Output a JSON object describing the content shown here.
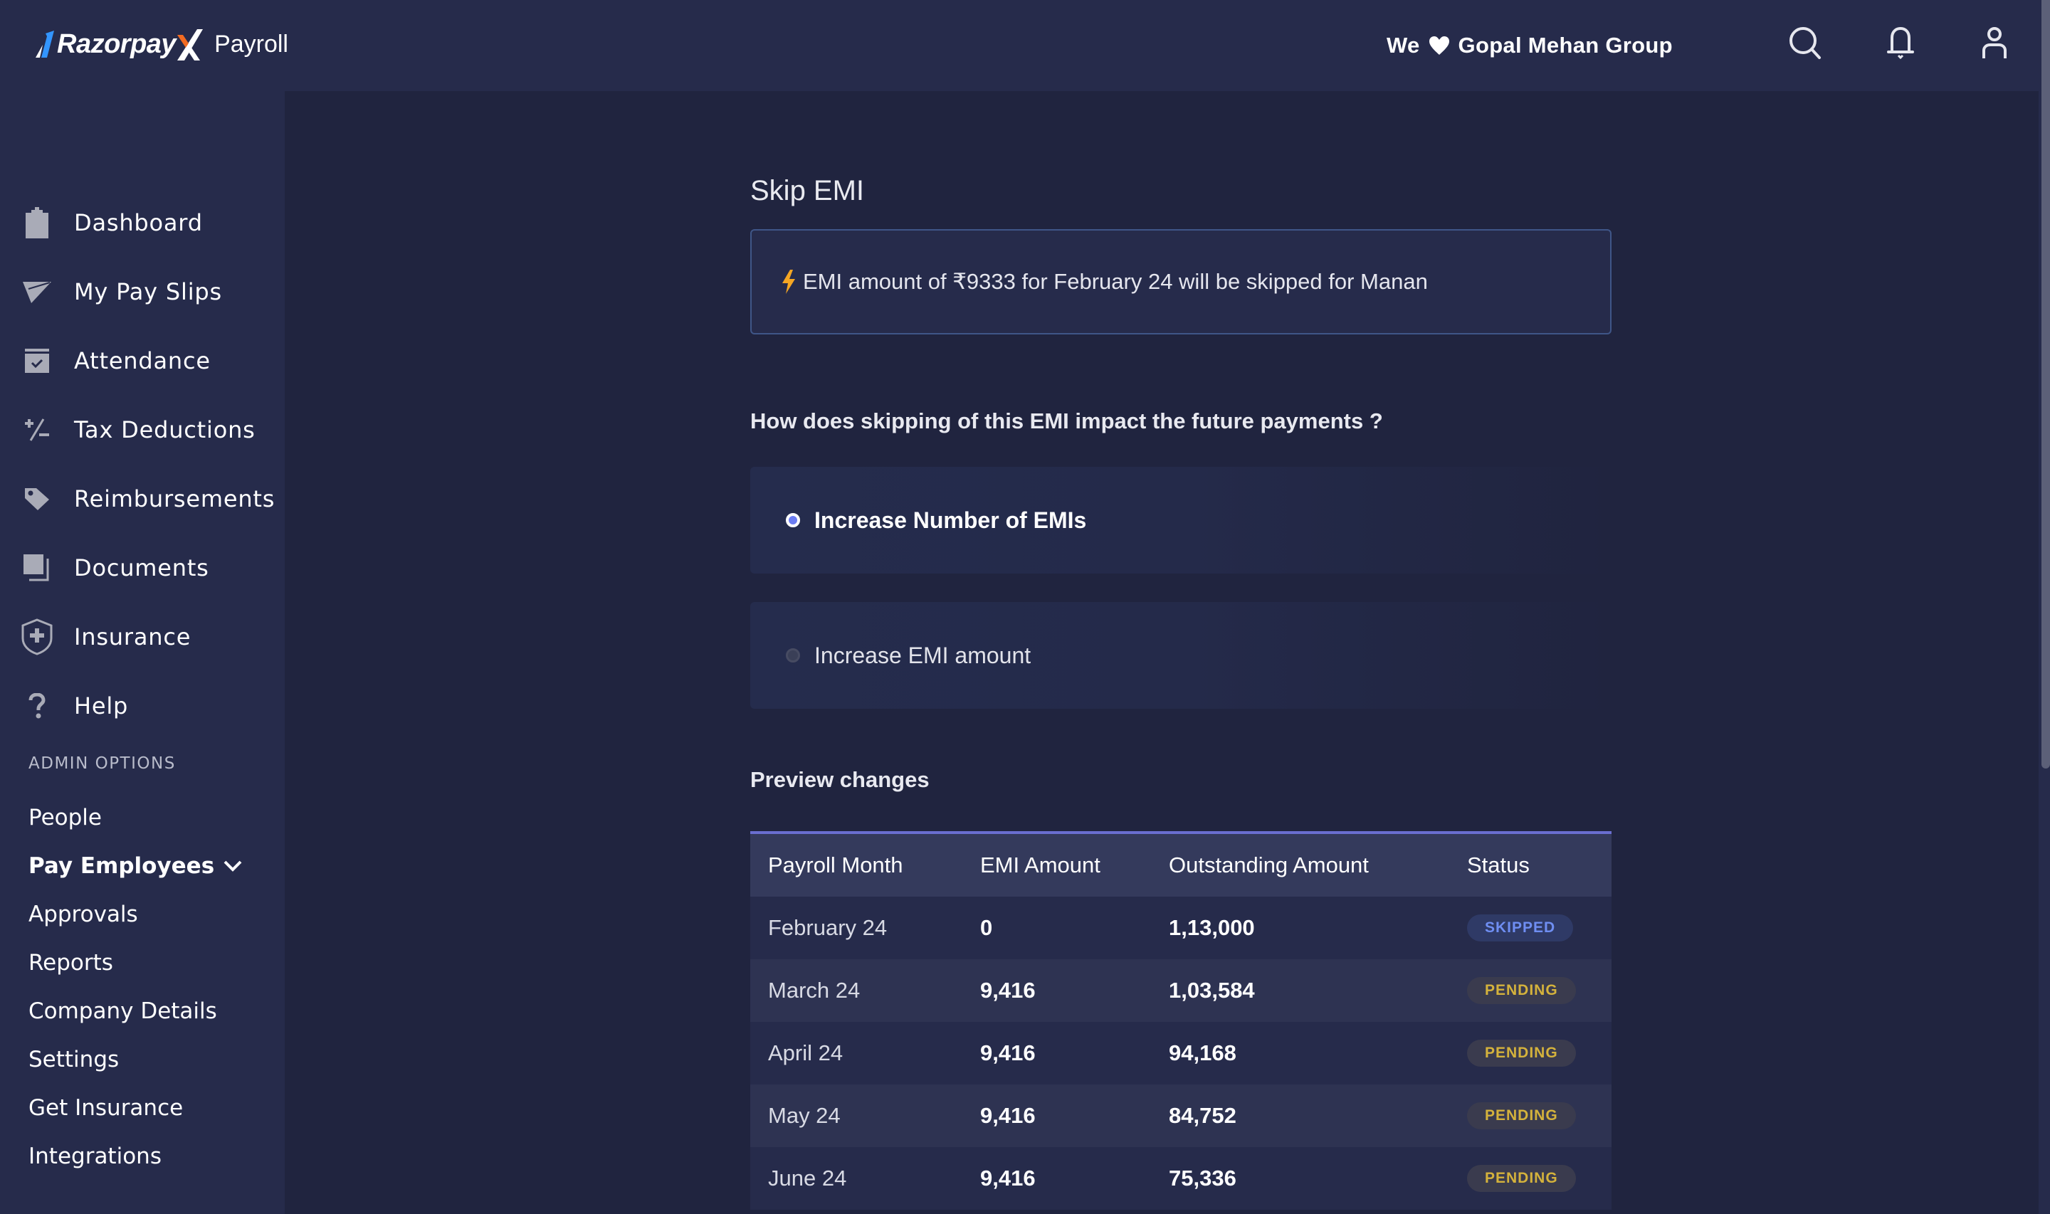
{
  "header": {
    "brand": "Razorpay",
    "product": "Payroll",
    "org_prefix": "We",
    "org_name": "Gopal Mehan Group",
    "icons": [
      "search-icon",
      "bell-icon",
      "user-icon"
    ]
  },
  "sidebar": {
    "items": [
      {
        "label": "Dashboard",
        "icon": "clipboard-icon"
      },
      {
        "label": "My Pay Slips",
        "icon": "paper-plane-icon"
      },
      {
        "label": "Attendance",
        "icon": "calendar-check-icon"
      },
      {
        "label": "Tax Deductions",
        "icon": "plus-minus-icon"
      },
      {
        "label": "Reimbursements",
        "icon": "tag-icon"
      },
      {
        "label": "Documents",
        "icon": "documents-icon"
      },
      {
        "label": "Insurance",
        "icon": "shield-plus-icon"
      },
      {
        "label": "Help",
        "icon": "question-icon"
      }
    ],
    "admin_heading": "ADMIN OPTIONS",
    "admin_items": [
      {
        "label": "People"
      },
      {
        "label": "Pay Employees",
        "active": true
      },
      {
        "label": "Approvals"
      },
      {
        "label": "Reports"
      },
      {
        "label": "Company Details"
      },
      {
        "label": "Settings"
      },
      {
        "label": "Get Insurance"
      },
      {
        "label": "Integrations"
      }
    ]
  },
  "main": {
    "title": "Skip EMI",
    "info_message": "EMI amount of ₹9333 for February 24 will be skipped for Manan",
    "question": "How does skipping of this EMI impact the future payments ?",
    "options": [
      {
        "label": "Increase Number of EMIs",
        "selected": true
      },
      {
        "label": "Increase EMI amount",
        "selected": false
      }
    ],
    "preview_title": "Preview changes",
    "table": {
      "columns": [
        "Payroll Month",
        "EMI Amount",
        "Outstanding Amount",
        "Status"
      ],
      "rows": [
        {
          "month": "February 24",
          "emi": "0",
          "outstanding": "1,13,000",
          "status": "SKIPPED"
        },
        {
          "month": "March 24",
          "emi": "9,416",
          "outstanding": "1,03,584",
          "status": "PENDING"
        },
        {
          "month": "April 24",
          "emi": "9,416",
          "outstanding": "94,168",
          "status": "PENDING"
        },
        {
          "month": "May 24",
          "emi": "9,416",
          "outstanding": "84,752",
          "status": "PENDING"
        },
        {
          "month": "June 24",
          "emi": "9,416",
          "outstanding": "75,336",
          "status": "PENDING"
        }
      ]
    }
  },
  "colors": {
    "accent": "#6b7cf2",
    "skipped": "#6f8ef2",
    "pending": "#d4b23c",
    "brand_orange": "#f26b21",
    "brand_blue": "#3395ff"
  }
}
